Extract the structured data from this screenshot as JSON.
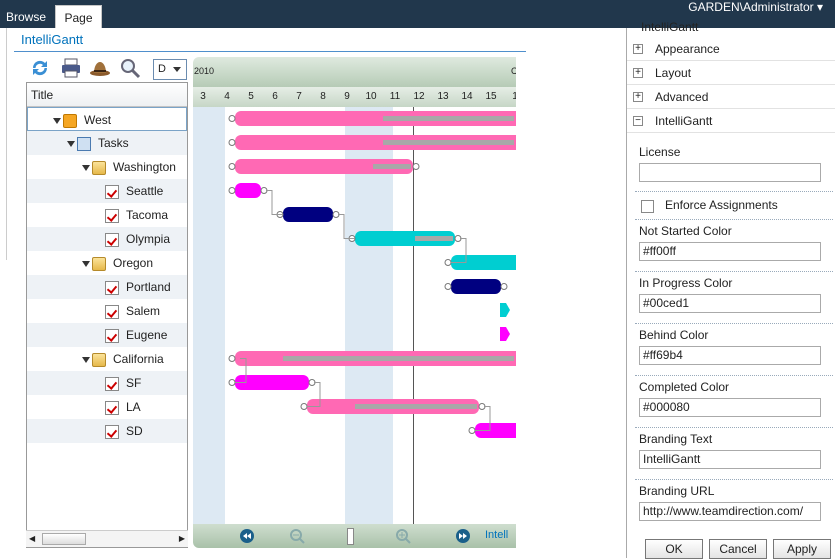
{
  "ribbon": {
    "browse": "Browse",
    "page": "Page",
    "user": "GARDEN\\Administrator ▾"
  },
  "webpart": {
    "title": "IntelliGantt"
  },
  "toolbar": {
    "view_value": "D"
  },
  "grid": {
    "header": "Title",
    "rows": [
      {
        "label": "West",
        "icon": "project-icon"
      },
      {
        "label": "Tasks",
        "icon": "tasks-icon"
      },
      {
        "label": "Washington",
        "icon": "folder-icon"
      },
      {
        "label": "Seattle",
        "icon": "task-icon"
      },
      {
        "label": "Tacoma",
        "icon": "task-icon"
      },
      {
        "label": "Olympia",
        "icon": "task-icon"
      },
      {
        "label": "Oregon",
        "icon": "folder-icon"
      },
      {
        "label": "Portland",
        "icon": "task-icon"
      },
      {
        "label": "Salem",
        "icon": "task-icon"
      },
      {
        "label": "Eugene",
        "icon": "task-icon"
      },
      {
        "label": "California",
        "icon": "folder-icon"
      },
      {
        "label": "SF",
        "icon": "task-icon"
      },
      {
        "label": "LA",
        "icon": "task-icon"
      },
      {
        "label": "SD",
        "icon": "task-icon"
      }
    ]
  },
  "gantt": {
    "year_left": "2010",
    "year_right": "C",
    "ticks": [
      "3",
      "4",
      "5",
      "6",
      "7",
      "8",
      "9",
      "10",
      "11",
      "12",
      "13",
      "14",
      "15",
      "1"
    ],
    "footer_brand": "Intell"
  },
  "panel": {
    "top_cut": "IntelliGantt",
    "sections": [
      "Appearance",
      "Layout",
      "Advanced",
      "IntelliGantt"
    ],
    "license_label": "License",
    "license_value": "",
    "enforce_label": "Enforce Assignments",
    "not_started_label": "Not Started Color",
    "not_started_value": "#ff00ff",
    "in_progress_label": "In Progress Color",
    "in_progress_value": "#00ced1",
    "behind_label": "Behind Color",
    "behind_value": "#ff69b4",
    "completed_label": "Completed Color",
    "completed_value": "#000080",
    "branding_text_label": "Branding Text",
    "branding_text_value": "IntelliGantt",
    "branding_url_label": "Branding URL",
    "branding_url_value": "http://www.teamdirection.com/",
    "ok": "OK",
    "cancel": "Cancel",
    "apply": "Apply"
  },
  "colors": {
    "not_started": "#ff00ff",
    "in_progress": "#00ced1",
    "behind": "#ff69b4",
    "completed": "#000080"
  }
}
